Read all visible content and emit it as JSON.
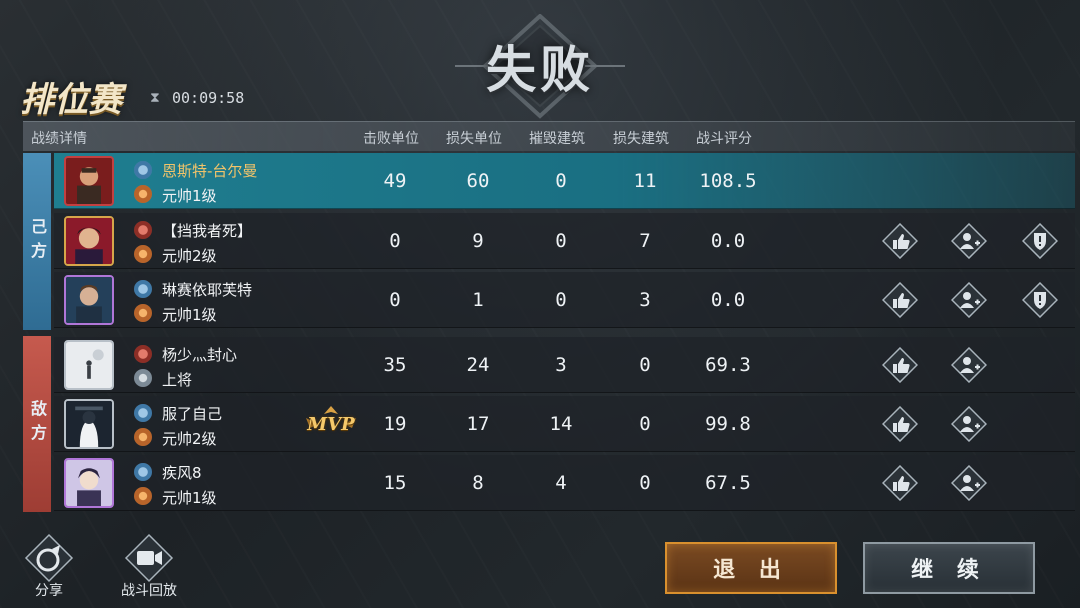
{
  "result": {
    "title": "失败"
  },
  "mode": {
    "title": "排位赛",
    "timer": "00:09:58"
  },
  "header": {
    "section": "战绩详情",
    "columns": [
      "击败单位",
      "损失单位",
      "摧毁建筑",
      "损失建筑",
      "战斗评分"
    ]
  },
  "teams": {
    "ally": "己方",
    "enemy": "敌方"
  },
  "players": [
    {
      "name": "恩斯特-台尔曼",
      "rank": "元帅1级",
      "kills": "49",
      "losses": "60",
      "destroyed": "0",
      "lost_buildings": "11",
      "score": "108.5"
    },
    {
      "name": "【挡我者死】",
      "rank": "元帅2级",
      "kills": "0",
      "losses": "9",
      "destroyed": "0",
      "lost_buildings": "7",
      "score": "0.0"
    },
    {
      "name": "琳赛依耶芙特",
      "rank": "元帅1级",
      "kills": "0",
      "losses": "1",
      "destroyed": "0",
      "lost_buildings": "3",
      "score": "0.0"
    },
    {
      "name": "杨少灬封心",
      "rank": "上将",
      "kills": "35",
      "losses": "24",
      "destroyed": "3",
      "lost_buildings": "0",
      "score": "69.3"
    },
    {
      "name": "服了自己",
      "rank": "元帅2级",
      "kills": "19",
      "losses": "17",
      "destroyed": "14",
      "lost_buildings": "0",
      "score": "99.8"
    },
    {
      "name": "疾风8",
      "rank": "元帅1级",
      "kills": "15",
      "losses": "8",
      "destroyed": "4",
      "lost_buildings": "0",
      "score": "67.5"
    }
  ],
  "mvp_label": "MVP",
  "bottom": {
    "share": "分享",
    "replay": "战斗回放",
    "exit": "退 出",
    "continue": "继 续"
  },
  "icons": [
    "hourglass-icon",
    "thumbs-up-icon",
    "add-friend-icon",
    "report-icon",
    "share-icon",
    "replay-camera-icon"
  ],
  "colors": {
    "ally": "#3f84b0",
    "enemy": "#b84b40",
    "highlight": "#1f7e90",
    "exit_border": "#d9902e",
    "gold_name": "#f2c46a"
  }
}
